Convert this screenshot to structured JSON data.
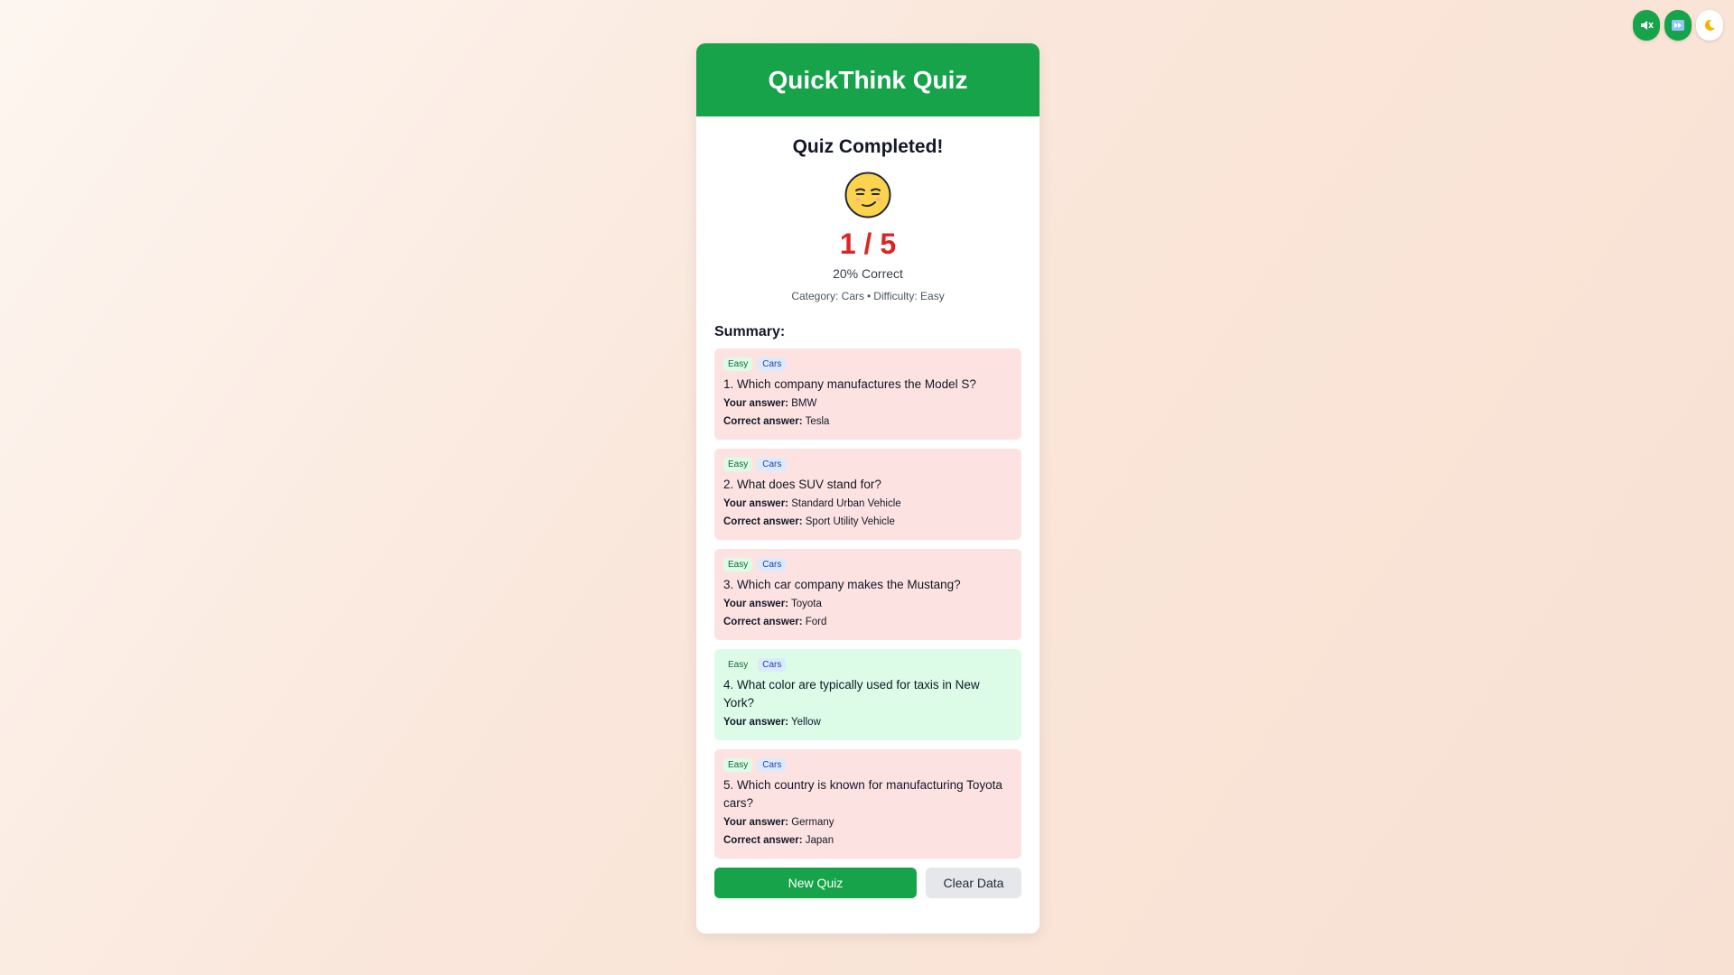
{
  "controls": {
    "sound_icon": "muted-speaker-icon",
    "skip_icon": "fast-forward-icon",
    "theme_icon": "moon-icon"
  },
  "header": {
    "title": "QuickThink Quiz"
  },
  "result": {
    "title": "Quiz Completed!",
    "emoji": "smirking-face-icon",
    "score": "1 / 5",
    "percent": "20% Correct",
    "category_label": "Category: Cars",
    "separator": "•",
    "difficulty_label": "Difficulty: Easy"
  },
  "summary": {
    "title": "Summary:",
    "your_answer_label": "Your answer:",
    "correct_answer_label": "Correct answer:",
    "items": [
      {
        "difficulty": "Easy",
        "category": "Cars",
        "question": "1. Which company manufactures the Model S?",
        "your_answer": "BMW",
        "correct_answer": "Tesla",
        "correct": false
      },
      {
        "difficulty": "Easy",
        "category": "Cars",
        "question": "2. What does SUV stand for?",
        "your_answer": "Standard Urban Vehicle",
        "correct_answer": "Sport Utility Vehicle",
        "correct": false
      },
      {
        "difficulty": "Easy",
        "category": "Cars",
        "question": "3. Which car company makes the Mustang?",
        "your_answer": "Toyota",
        "correct_answer": "Ford",
        "correct": false
      },
      {
        "difficulty": "Easy",
        "category": "Cars",
        "question": "4. What color are typically used for taxis in New York?",
        "your_answer": "Yellow",
        "correct_answer": null,
        "correct": true
      },
      {
        "difficulty": "Easy",
        "category": "Cars",
        "question": "5. Which country is known for manufacturing Toyota cars?",
        "your_answer": "Germany",
        "correct_answer": "Japan",
        "correct": false
      }
    ]
  },
  "buttons": {
    "new_quiz": "New Quiz",
    "clear_data": "Clear Data"
  },
  "colors": {
    "brand_green": "#16a34a",
    "score_red": "#dc2626",
    "wrong_bg": "#fde2e2",
    "right_bg": "#dcfce7"
  }
}
